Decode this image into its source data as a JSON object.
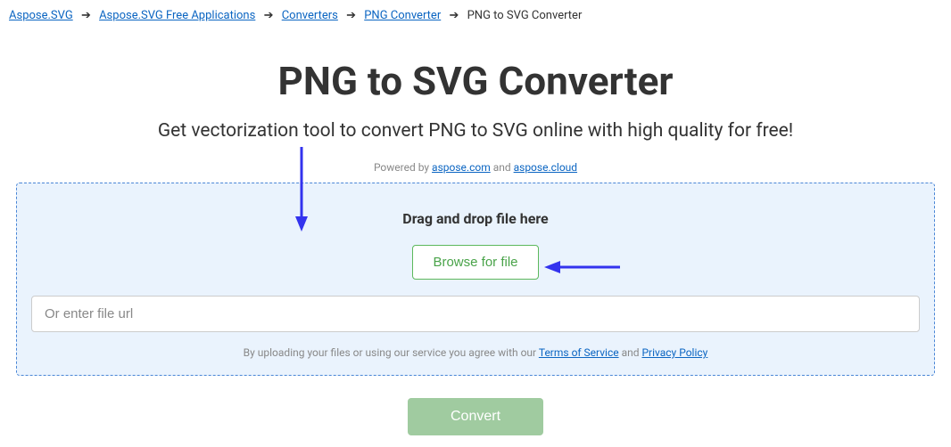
{
  "breadcrumb": {
    "items": [
      {
        "label": "Aspose.SVG"
      },
      {
        "label": "Aspose.SVG Free Applications"
      },
      {
        "label": "Converters"
      },
      {
        "label": "PNG Converter"
      }
    ],
    "current": "PNG to SVG Converter"
  },
  "header": {
    "title": "PNG to SVG Converter",
    "subtitle": "Get vectorization tool to convert PNG to SVG online with high quality for free!"
  },
  "powered": {
    "prefix": "Powered by ",
    "link1": "aspose.com",
    "and": " and ",
    "link2": "aspose.cloud"
  },
  "dropzone": {
    "label": "Drag and drop file here",
    "browse": "Browse for file",
    "url_placeholder": "Or enter file url"
  },
  "agree": {
    "prefix": "By uploading your files or using our service you agree with our ",
    "tos": "Terms of Service",
    "and": " and ",
    "pp": "Privacy Policy"
  },
  "convert": {
    "label": "Convert"
  }
}
